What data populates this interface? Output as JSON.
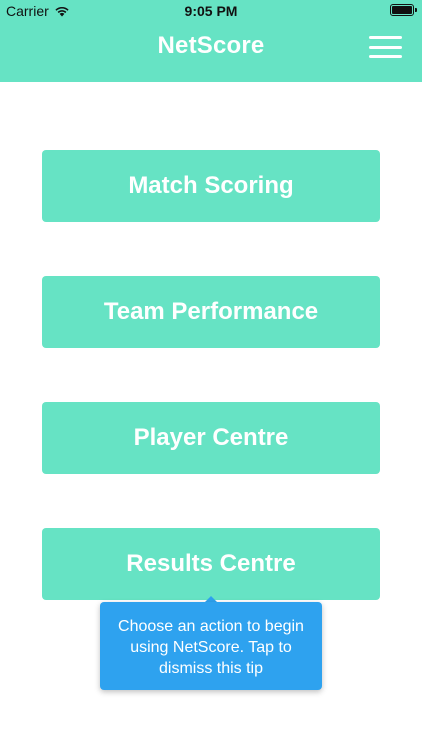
{
  "status_bar": {
    "carrier": "Carrier",
    "time": "9:05 PM",
    "wifi_icon": "wifi-icon",
    "battery_icon": "battery-icon"
  },
  "header": {
    "title": "NetScore",
    "menu_icon": "hamburger-menu-icon"
  },
  "actions": [
    {
      "label": "Match Scoring"
    },
    {
      "label": "Team Performance"
    },
    {
      "label": "Player Centre"
    },
    {
      "label": "Results Centre"
    }
  ],
  "tip": {
    "text": "Choose an action to begin using NetScore. Tap to dismiss this tip"
  },
  "colors": {
    "primary": "#66e3c4",
    "tip_background": "#2ea2ef",
    "text_on_primary": "#ffffff"
  }
}
